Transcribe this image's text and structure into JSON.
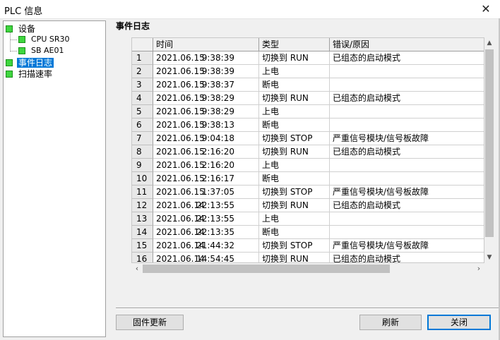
{
  "window": {
    "title": "PLC 信息",
    "close_glyph": "✕"
  },
  "tree": {
    "device": "设备",
    "cpu": "CPU SR30",
    "sb": "SB AE01",
    "event_log": "事件日志",
    "scan_rate": "扫描速率"
  },
  "section_title": "事件日志",
  "table": {
    "headers": {
      "num": "",
      "time": "时间",
      "type": "类型",
      "error": "错误/原因"
    },
    "rows": [
      {
        "num": "1",
        "date": "2021.06.15",
        "time": "9:38:39",
        "type": "切换到 RUN",
        "error": "已组态的启动模式"
      },
      {
        "num": "2",
        "date": "2021.06.15",
        "time": "9:38:39",
        "type": "上电",
        "error": ""
      },
      {
        "num": "3",
        "date": "2021.06.15",
        "time": "9:38:37",
        "type": "断电",
        "error": ""
      },
      {
        "num": "4",
        "date": "2021.06.15",
        "time": "9:38:29",
        "type": "切换到 RUN",
        "error": "已组态的启动模式"
      },
      {
        "num": "5",
        "date": "2021.06.15",
        "time": "9:38:29",
        "type": "上电",
        "error": ""
      },
      {
        "num": "6",
        "date": "2021.06.15",
        "time": "9:38:13",
        "type": "断电",
        "error": ""
      },
      {
        "num": "7",
        "date": "2021.06.15",
        "time": "9:04:18",
        "type": "切换到 STOP",
        "error": "严重信号模块/信号板故障"
      },
      {
        "num": "8",
        "date": "2021.06.15",
        "time": "2:16:20",
        "type": "切换到 RUN",
        "error": "已组态的启动模式"
      },
      {
        "num": "9",
        "date": "2021.06.15",
        "time": "2:16:20",
        "type": "上电",
        "error": ""
      },
      {
        "num": "10",
        "date": "2021.06.15",
        "time": "2:16:17",
        "type": "断电",
        "error": ""
      },
      {
        "num": "11",
        "date": "2021.06.15",
        "time": "1:37:05",
        "type": "切换到 STOP",
        "error": "严重信号模块/信号板故障"
      },
      {
        "num": "12",
        "date": "2021.06.14",
        "time": "22:13:55",
        "type": "切换到 RUN",
        "error": "已组态的启动模式"
      },
      {
        "num": "13",
        "date": "2021.06.14",
        "time": "22:13:55",
        "type": "上电",
        "error": ""
      },
      {
        "num": "14",
        "date": "2021.06.14",
        "time": "22:13:35",
        "type": "断电",
        "error": ""
      },
      {
        "num": "15",
        "date": "2021.06.14",
        "time": "21:44:32",
        "type": "切换到 STOP",
        "error": "严重信号模块/信号板故障"
      },
      {
        "num": "16",
        "date": "2021.06.14",
        "time": "14:54:45",
        "type": "切换到 RUN",
        "error": "已组态的启动模式"
      }
    ]
  },
  "buttons": {
    "firmware": "固件更新",
    "refresh": "刷新",
    "close": "关闭"
  },
  "colors": {
    "status_ok": "#3fd63f",
    "selection": "#0078d7"
  }
}
